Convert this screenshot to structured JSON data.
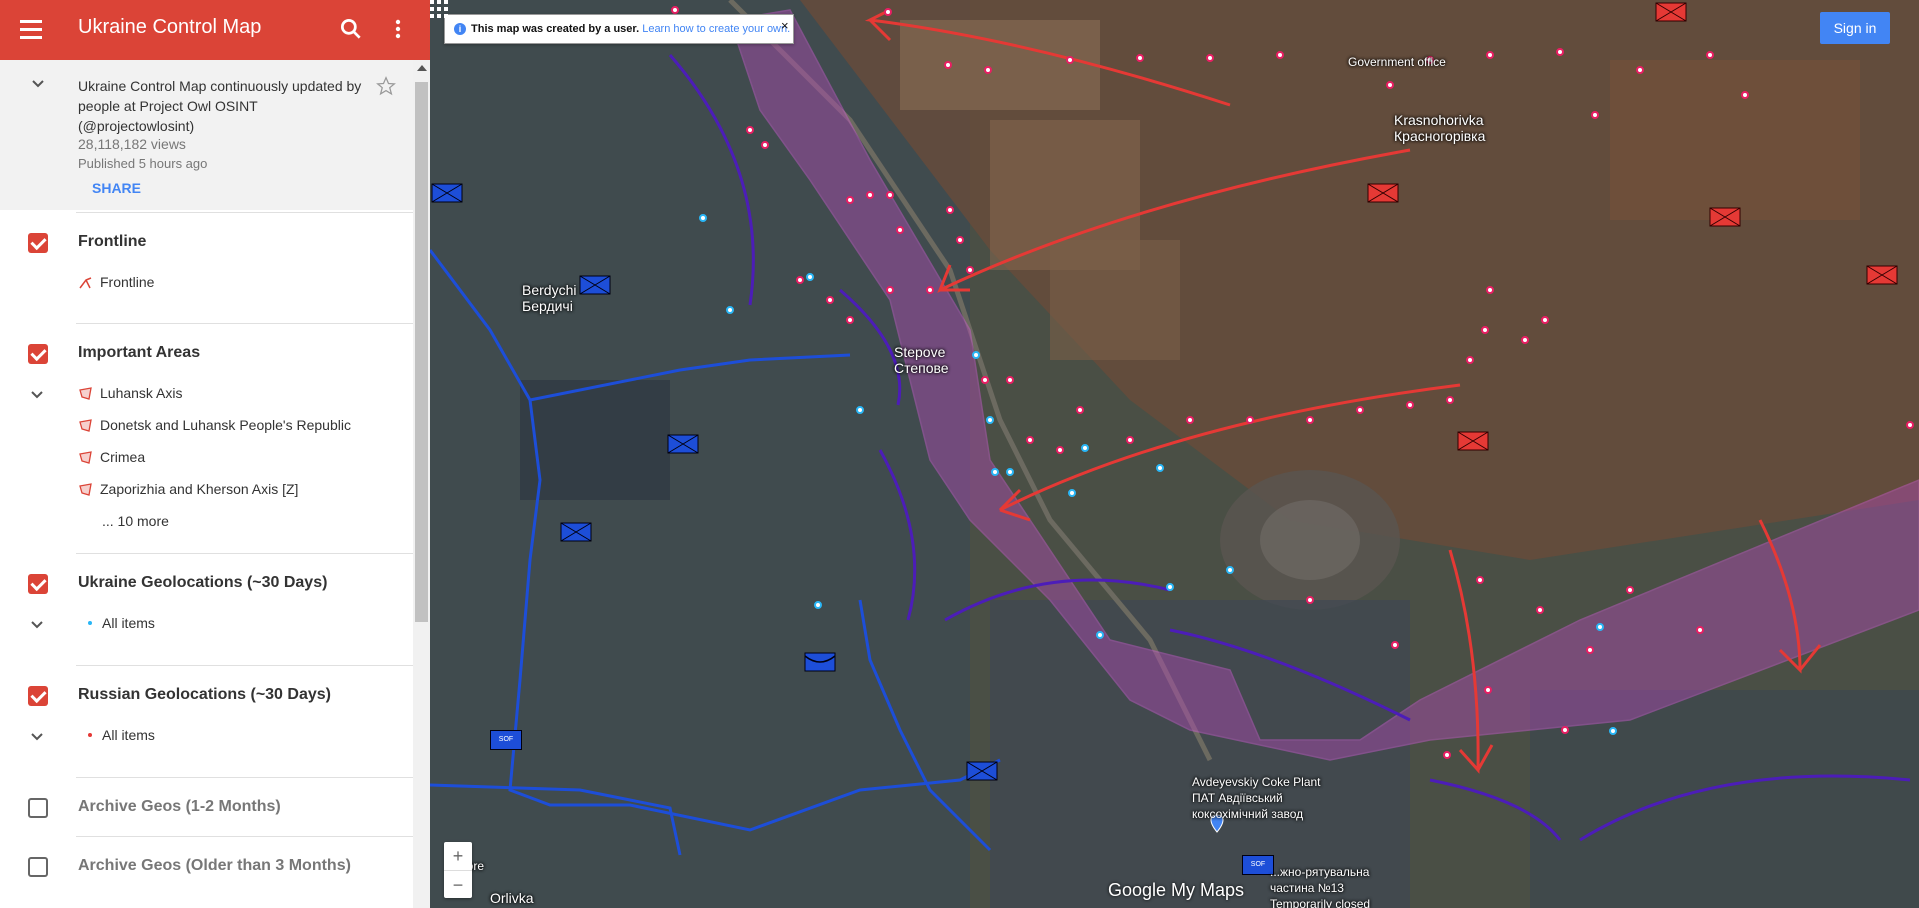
{
  "app": {
    "title": "Ukraine Control Map",
    "description": "Ukraine Control Map continuously updated by people at Project Owl OSINT (@projectowlosint)",
    "views": "28,118,182 views",
    "published": "Published 5 hours ago",
    "share_label": "SHARE"
  },
  "layers": [
    {
      "title": "Frontline",
      "checked": true,
      "items": [
        "Frontline"
      ]
    },
    {
      "title": "Important Areas",
      "checked": true,
      "items": [
        "Luhansk Axis",
        "Donetsk and Luhansk People's Republic",
        "Crimea",
        "Zaporizhia and Kherson Axis [Z]"
      ],
      "more": "... 10 more"
    },
    {
      "title": "Ukraine Geolocations (~30 Days)",
      "checked": true,
      "items": [
        "All items"
      ]
    },
    {
      "title": "Russian Geolocations (~30 Days)",
      "checked": true,
      "items": [
        "All items"
      ]
    },
    {
      "title": "Archive Geos (1-2 Months)",
      "checked": false
    },
    {
      "title": "Archive Geos (Older than 3 Months)",
      "checked": false
    }
  ],
  "map": {
    "banner_text": "This map was created by a user.",
    "banner_link": "Learn how to create your own.",
    "close_glyph": "×",
    "signin_label": "Sign in",
    "zoom_in": "+",
    "zoom_out": "−",
    "wordmark": "Google My Maps",
    "places": {
      "berdychi": "Berdychi",
      "berdychi_ua": "Бердичі",
      "stepove": "Stepove",
      "stepove_ua": "Степове",
      "krasnohorivka": "Krasnohorivka",
      "krasnohorivka_ua": "Красногорівка",
      "government_office": "Government office",
      "coke_plant": "Avdeyevskiy Coke Plant",
      "coke_plant_ua1": "ПАТ Авдіївський",
      "coke_plant_ua2": "коксохімічний завод",
      "orlivka": "Orlivka",
      "store": "y store",
      "rescue_ua": "...жно-рятувальна",
      "rescue_ua2": "частина №13",
      "temporarily_closed": "Temporarily closed"
    },
    "unit_label": "SOF",
    "colors": {
      "ukraine": "#1d4ed8",
      "russia": "#e53935",
      "frontline_area": "#b04bb5",
      "ua_geo_dot": "#29b6f6",
      "ru_geo_dot": "#e91e63"
    }
  }
}
